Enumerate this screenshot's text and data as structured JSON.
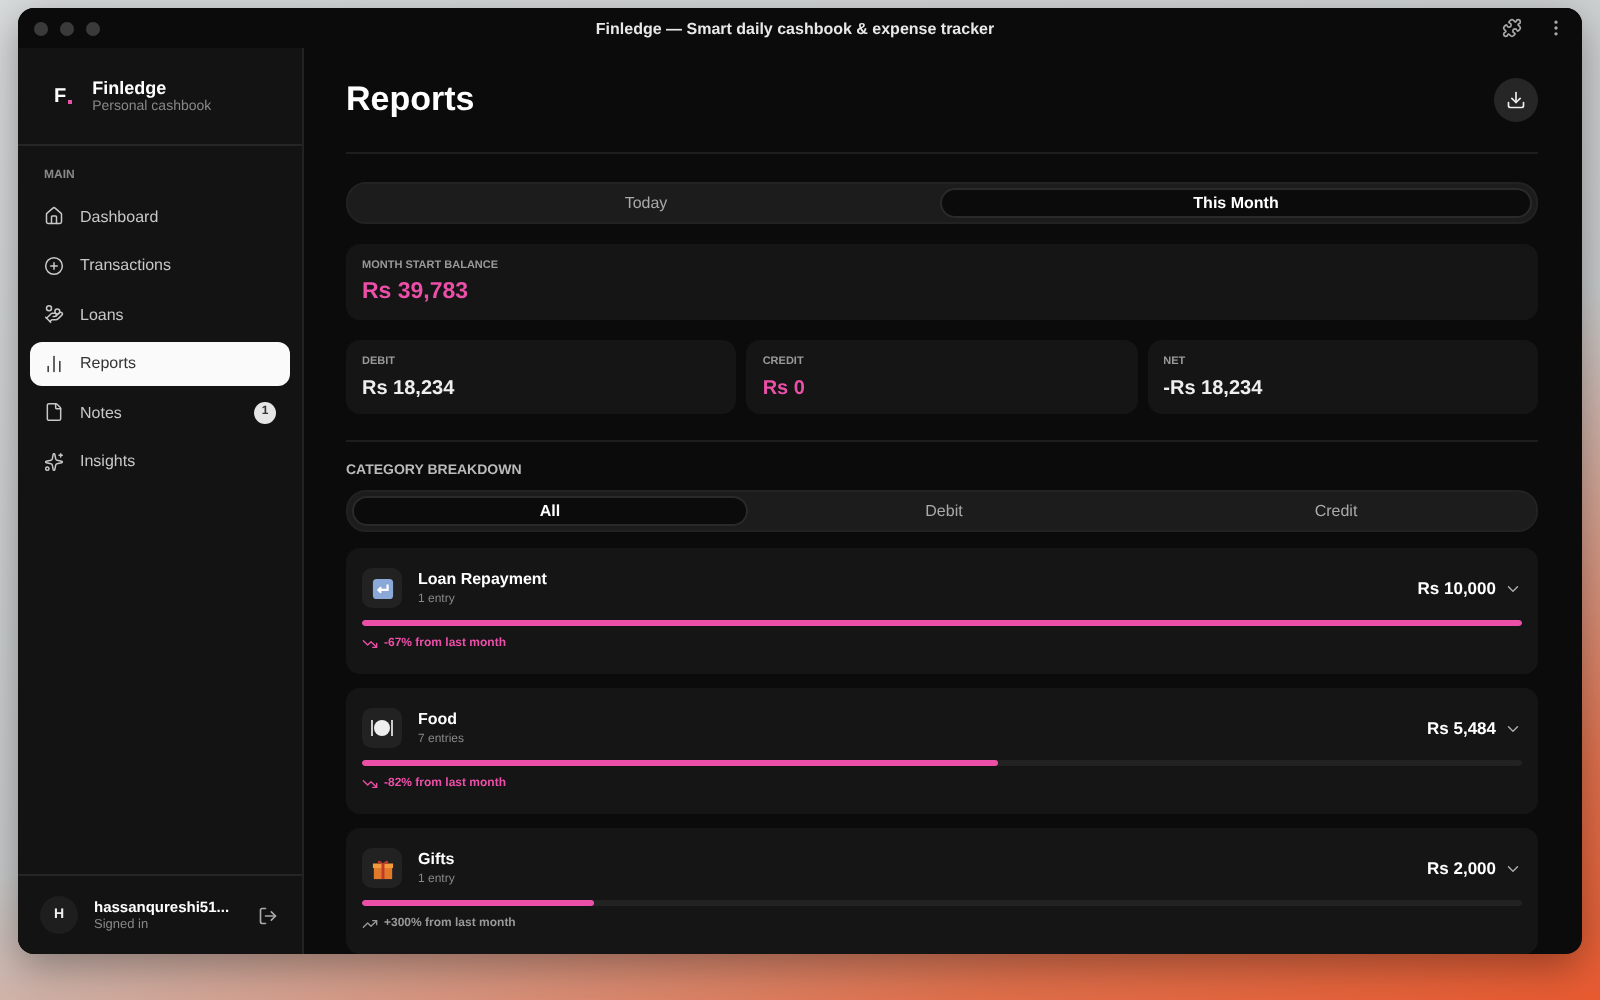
{
  "window": {
    "title": "Finledge — Smart daily cashbook & expense tracker"
  },
  "sidebar": {
    "brand": {
      "logo": "F",
      "name": "Finledge",
      "subtitle": "Personal cashbook"
    },
    "section": "MAIN",
    "items": [
      {
        "label": "Dashboard",
        "kind": "home",
        "selected": false
      },
      {
        "label": "Transactions",
        "kind": "add",
        "selected": false
      },
      {
        "label": "Loans",
        "kind": "coins",
        "selected": false
      },
      {
        "label": "Reports",
        "kind": "chart",
        "selected": true
      },
      {
        "label": "Notes",
        "kind": "note",
        "selected": false,
        "badge": "1"
      },
      {
        "label": "Insights",
        "kind": "sparkle",
        "selected": false
      }
    ],
    "user": {
      "avatar": "H",
      "name": "hassanqureshi51...",
      "status": "Signed in"
    }
  },
  "page": {
    "title": "Reports"
  },
  "period_tabs": [
    {
      "label": "Today",
      "selected": false
    },
    {
      "label": "This Month",
      "selected": true
    }
  ],
  "balance": {
    "label": "MONTH START BALANCE",
    "value": "Rs 39,783"
  },
  "stats": [
    {
      "label": "DEBIT",
      "value": "Rs 18,234",
      "kind": "plain"
    },
    {
      "label": "CREDIT",
      "value": "Rs 0",
      "kind": "accent"
    },
    {
      "label": "NET",
      "value": "-Rs 18,234",
      "kind": "plain"
    }
  ],
  "breakdown": {
    "title": "CATEGORY BREAKDOWN",
    "filters": [
      {
        "label": "All",
        "selected": true
      },
      {
        "label": "Debit",
        "selected": false
      },
      {
        "label": "Credit",
        "selected": false
      }
    ],
    "categories": [
      {
        "name": "Loan Repayment",
        "entries": "1 entry",
        "amount": "Rs 10,000",
        "kind": "loan",
        "level": 1,
        "trend": {
          "kind": "down",
          "text": "-67% from last month"
        }
      },
      {
        "name": "Food",
        "entries": "7 entries",
        "amount": "Rs 5,484",
        "kind": "food",
        "level": 0.548,
        "trend": {
          "kind": "down",
          "text": "-82% from last month"
        }
      },
      {
        "name": "Gifts",
        "entries": "1 entry",
        "amount": "Rs 2,000",
        "kind": "gift",
        "level": 0.2,
        "trend": {
          "kind": "up",
          "text": "+300% from last month"
        }
      }
    ]
  }
}
